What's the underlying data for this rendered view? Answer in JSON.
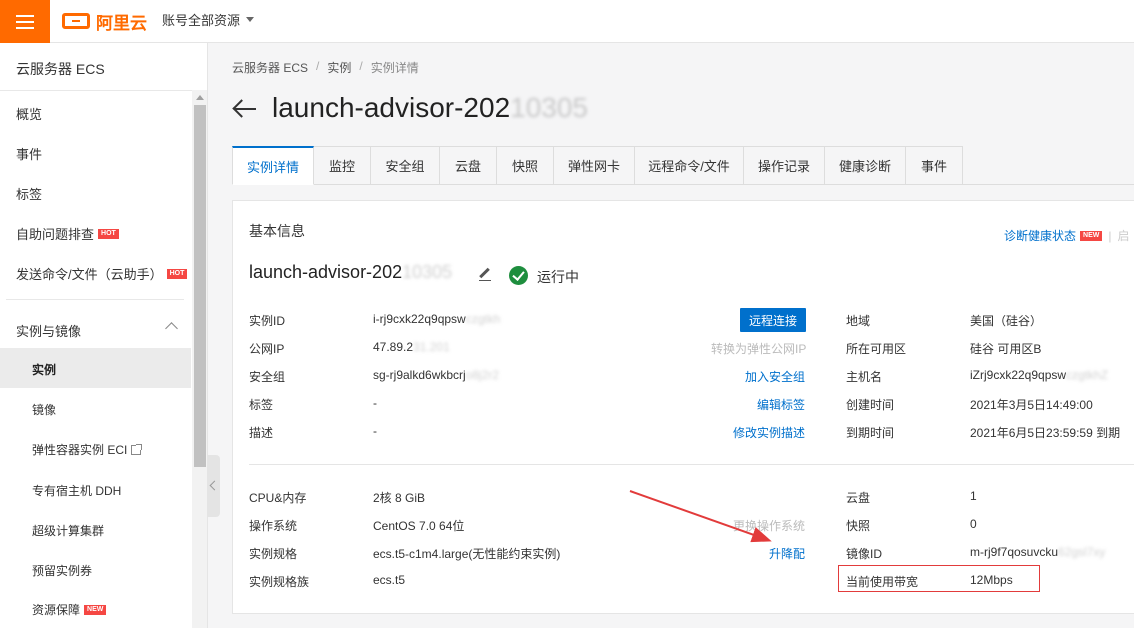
{
  "topbar": {
    "brand": "阿里云",
    "account_menu": "账号全部资源"
  },
  "sidebar": {
    "title": "云服务器 ECS",
    "items": [
      {
        "label": "概览"
      },
      {
        "label": "事件"
      },
      {
        "label": "标签"
      },
      {
        "label": "自助问题排查",
        "badge": "HOT"
      },
      {
        "label": "发送命令/文件（云助手）",
        "badge": "HOT"
      }
    ],
    "group": {
      "label": "实例与镜像",
      "items": [
        {
          "label": "实例"
        },
        {
          "label": "镜像"
        },
        {
          "label": "弹性容器实例 ECI"
        },
        {
          "label": "专有宿主机 DDH"
        },
        {
          "label": "超级计算集群"
        },
        {
          "label": "预留实例券"
        },
        {
          "label": "资源保障",
          "badge": "NEW"
        }
      ]
    }
  },
  "breadcrumb": [
    "云服务器 ECS",
    "实例",
    "实例详情"
  ],
  "page": {
    "title_visible": "launch-advisor-202",
    "title_blurred": "10305"
  },
  "tabs": [
    "实例详情",
    "监控",
    "安全组",
    "云盘",
    "快照",
    "弹性网卡",
    "远程命令/文件",
    "操作记录",
    "健康诊断",
    "事件"
  ],
  "basic": {
    "section_title": "基本信息",
    "diagnose_link": "诊断健康状态",
    "diagnose_badge": "NEW",
    "trailing_link": "启",
    "instance_name_visible": "launch-advisor-202",
    "instance_name_blurred": "10305",
    "status": "运行中"
  },
  "left_rows": [
    {
      "label": "实例ID",
      "value": "i-rj9cxk22q9qpsw",
      "blurred": "czgtkh"
    },
    {
      "label": "公网IP",
      "value": "47.89.2",
      "blurred": "31.201"
    },
    {
      "label": "安全组",
      "value": "sg-rj9alkd6wkbcrj",
      "blurred": "o8j2r2"
    },
    {
      "label": "标签",
      "value": "-",
      "blurred": ""
    },
    {
      "label": "描述",
      "value": "-",
      "blurred": ""
    }
  ],
  "left_actions": {
    "remote_connect": "远程连接",
    "convert_eip": "转换为弹性公网IP",
    "add_security_group": "加入安全组",
    "edit_tags": "编辑标签",
    "edit_description": "修改实例描述"
  },
  "right_rows": [
    {
      "label": "地域",
      "value": "美国（硅谷）",
      "blurred": ""
    },
    {
      "label": "所在可用区",
      "value": "硅谷 可用区B",
      "blurred": ""
    },
    {
      "label": "主机名",
      "value": "iZrj9cxk22q9qpsw",
      "blurred": "czgtkhZ"
    },
    {
      "label": "创建时间",
      "value": "2021年3月5日14:49:00",
      "blurred": ""
    },
    {
      "label": "到期时间",
      "value": "2021年6月5日23:59:59 到期",
      "blurred": ""
    }
  ],
  "config_rows": [
    {
      "label": "CPU&内存",
      "value": "2核 8 GiB"
    },
    {
      "label": "操作系统",
      "value": "CentOS 7.0 64位"
    },
    {
      "label": "实例规格",
      "value": "ecs.t5-c1m4.large(无性能约束实例)"
    },
    {
      "label": "实例规格族",
      "value": "ecs.t5"
    }
  ],
  "config_actions": {
    "change_os": "更换操作系统",
    "upgrade": "升降配"
  },
  "storage_rows": [
    {
      "label": "云盘",
      "value": "1",
      "blurred": ""
    },
    {
      "label": "快照",
      "value": "0",
      "blurred": ""
    },
    {
      "label": "镜像ID",
      "value": "m-rj9f7qosuvcku",
      "blurred": "62gsl7xy"
    },
    {
      "label": "当前使用带宽",
      "value": "12Mbps",
      "blurred": ""
    }
  ]
}
